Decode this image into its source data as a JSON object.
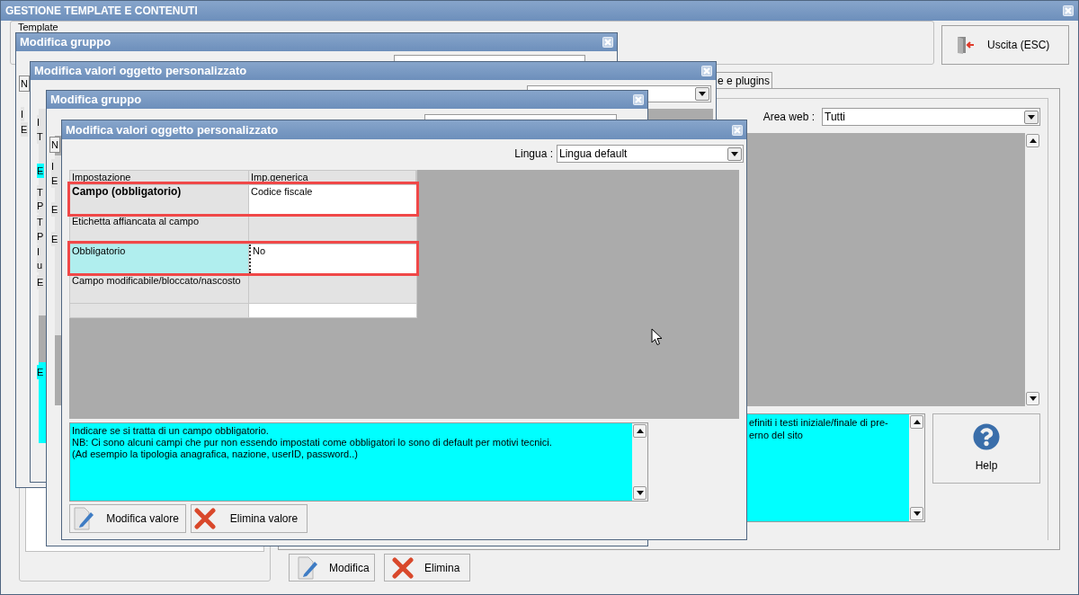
{
  "main_window": {
    "title": "GESTIONE TEMPLATE E CONTENUTI",
    "group_label": "Template",
    "exit_button": "Uscita (ESC)",
    "tab": {
      "label": "e e plugins",
      "selected": true
    },
    "area_web": {
      "label": "Area web :",
      "value": "Tutti"
    },
    "description": [
      "efiniti i testi iniziale/finale di pre-",
      "erno del sito"
    ],
    "help_button": "Help",
    "buttons": [
      {
        "kind": "edit",
        "label": "Modifica"
      },
      {
        "kind": "delete",
        "label": "Elimina"
      }
    ]
  },
  "dialogs": [
    {
      "title": "Modifica gruppo",
      "fragments": [
        {
          "kind": "tab",
          "text": "N",
          "selected": false
        },
        {
          "kind": "cell",
          "text": "I",
          "selected": false
        },
        {
          "kind": "cell",
          "text": "E",
          "selected": false
        }
      ]
    },
    {
      "title": "Modifica valori oggetto personalizzato",
      "fragments": [
        {
          "kind": "cell",
          "text": "I",
          "selected": false
        },
        {
          "kind": "cell",
          "text": "T",
          "selected": false
        },
        {
          "kind": "cell",
          "text": "E",
          "selected": true
        },
        {
          "kind": "cell",
          "text": "T",
          "selected": false
        },
        {
          "kind": "cell",
          "text": "P",
          "selected": false
        },
        {
          "kind": "cell",
          "text": "T",
          "selected": false
        },
        {
          "kind": "cell",
          "text": "P",
          "selected": false
        },
        {
          "kind": "cell",
          "text": "I",
          "selected": false
        },
        {
          "kind": "cell",
          "text": "u",
          "selected": false
        },
        {
          "kind": "cell",
          "text": "E",
          "selected": false
        },
        {
          "kind": "cell",
          "text": "E",
          "selected": true
        }
      ]
    },
    {
      "title": "Modifica gruppo",
      "fragments": [
        {
          "kind": "tab",
          "text": "N",
          "selected": false
        },
        {
          "kind": "cell",
          "text": "I",
          "selected": false
        },
        {
          "kind": "cell",
          "text": "E",
          "selected": false
        },
        {
          "kind": "cell",
          "text": "E",
          "selected": false
        },
        {
          "kind": "cell",
          "text": "E",
          "selected": false
        }
      ]
    }
  ],
  "active_dialog": {
    "title": "Modifica valori oggetto personalizzato",
    "language": {
      "label": "Lingua :",
      "value": "Lingua default"
    },
    "table": {
      "columns": [
        "Impostazione",
        "Imp.generica"
      ],
      "rows": [
        {
          "setting": "Campo (obbligatorio)",
          "value": "Codice fiscale",
          "bold": true,
          "editable": true,
          "selected": false,
          "highlighted": true
        },
        {
          "setting": "Etichetta affiancata al campo",
          "bold": false,
          "editable": false,
          "selected": false,
          "highlighted": false
        },
        {
          "setting": "Obbligatorio",
          "value": "No",
          "bold": false,
          "editable": true,
          "selected": true,
          "highlighted": true
        },
        {
          "setting": "Campo modificabile/bloccato/nascosto",
          "bold": false,
          "editable": false,
          "selected": false,
          "highlighted": false
        },
        {
          "bold": false,
          "editable": true,
          "selected": false,
          "highlighted": false
        }
      ]
    },
    "note": [
      "Indicare se si tratta di un campo obbligatorio.",
      "NB: Ci sono alcuni campi che pur non essendo impostati come obbligatori lo sono di default per motivi tecnici.",
      "(Ad esempio la tipologia anagrafica, nazione, userID, password..)"
    ],
    "buttons": [
      {
        "kind": "edit",
        "label": "Modifica valore"
      },
      {
        "kind": "delete",
        "label": "Elimina valore"
      }
    ]
  }
}
